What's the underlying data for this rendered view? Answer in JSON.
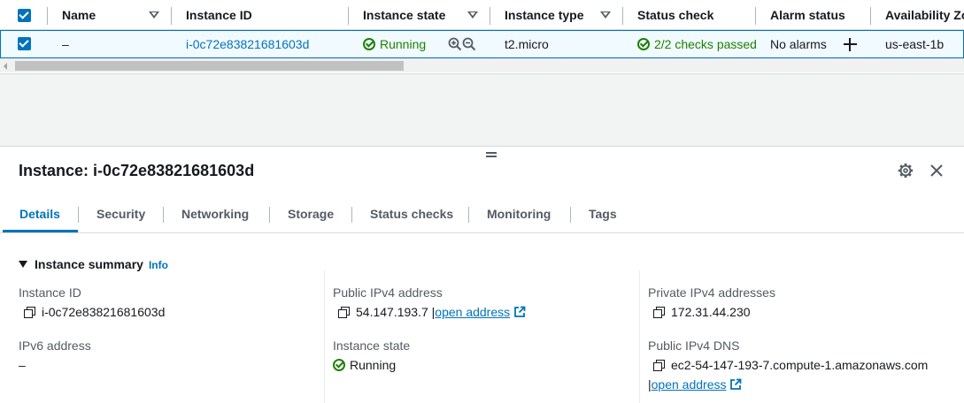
{
  "table": {
    "columns": {
      "name": "Name",
      "instance_id": "Instance ID",
      "instance_state": "Instance state",
      "instance_type": "Instance type",
      "status_check": "Status check",
      "alarm_status": "Alarm status",
      "availability_zone": "Availability Zo"
    },
    "row": {
      "name": "–",
      "instance_id": "i-0c72e83821681603d",
      "instance_state": "Running",
      "instance_type": "t2.micro",
      "status_check": "2/2 checks passed",
      "alarm_status": "No alarms",
      "availability_zone": "us-east-1b"
    }
  },
  "panel": {
    "title": "Instance: i-0c72e83821681603d",
    "tabs": [
      "Details",
      "Security",
      "Networking",
      "Storage",
      "Status checks",
      "Monitoring",
      "Tags"
    ],
    "section": {
      "title": "Instance summary",
      "info": "Info"
    },
    "fields": {
      "instance_id_label": "Instance ID",
      "instance_id_value": "i-0c72e83821681603d",
      "ipv6_label": "IPv6 address",
      "ipv6_value": "–",
      "public_ipv4_label": "Public IPv4 address",
      "public_ipv4_value": "54.147.193.7",
      "public_ipv4_sep": "|",
      "public_ipv4_link": "open address",
      "instance_state_label": "Instance state",
      "instance_state_value": "Running",
      "private_ipv4_label": "Private IPv4 addresses",
      "private_ipv4_value": "172.31.44.230",
      "public_dns_label": "Public IPv4 DNS",
      "public_dns_value": "ec2-54-147-193-7.compute-1.amazonaws.com",
      "public_dns_sep": "|",
      "public_dns_link": "open address"
    }
  },
  "colors": {
    "accent": "#0073bb",
    "success": "#1d8102",
    "border": "#d5dbdb"
  }
}
